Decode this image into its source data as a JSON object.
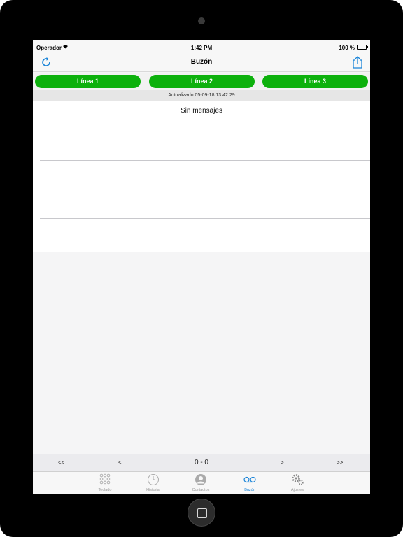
{
  "status_bar": {
    "carrier": "Operador",
    "time": "1:42 PM",
    "battery": "100 %",
    "battery_level": 1.0
  },
  "nav": {
    "title": "Buzón"
  },
  "lines": [
    {
      "label": "Línea 1"
    },
    {
      "label": "Línea 2"
    },
    {
      "label": "Línea 3"
    }
  ],
  "updated": "Actualizado 05-09-18 13:42:29",
  "messages": {
    "empty_text": "Sin mensajes"
  },
  "pager": {
    "first": "<<",
    "prev": "<",
    "range": "0 - 0",
    "next": ">",
    "last": ">>"
  },
  "tabs": [
    {
      "label": "Teclado",
      "icon": "keypad-icon",
      "active": false
    },
    {
      "label": "Historial",
      "icon": "clock-icon",
      "active": false
    },
    {
      "label": "Contactos",
      "icon": "contacts-icon",
      "active": false
    },
    {
      "label": "Buzón",
      "icon": "voicemail-icon",
      "active": true
    },
    {
      "label": "Ajustes",
      "icon": "gears-icon",
      "active": false
    }
  ],
  "colors": {
    "accent": "#1a84d8",
    "line_button": "#0db10d",
    "bezel": "#000000"
  }
}
